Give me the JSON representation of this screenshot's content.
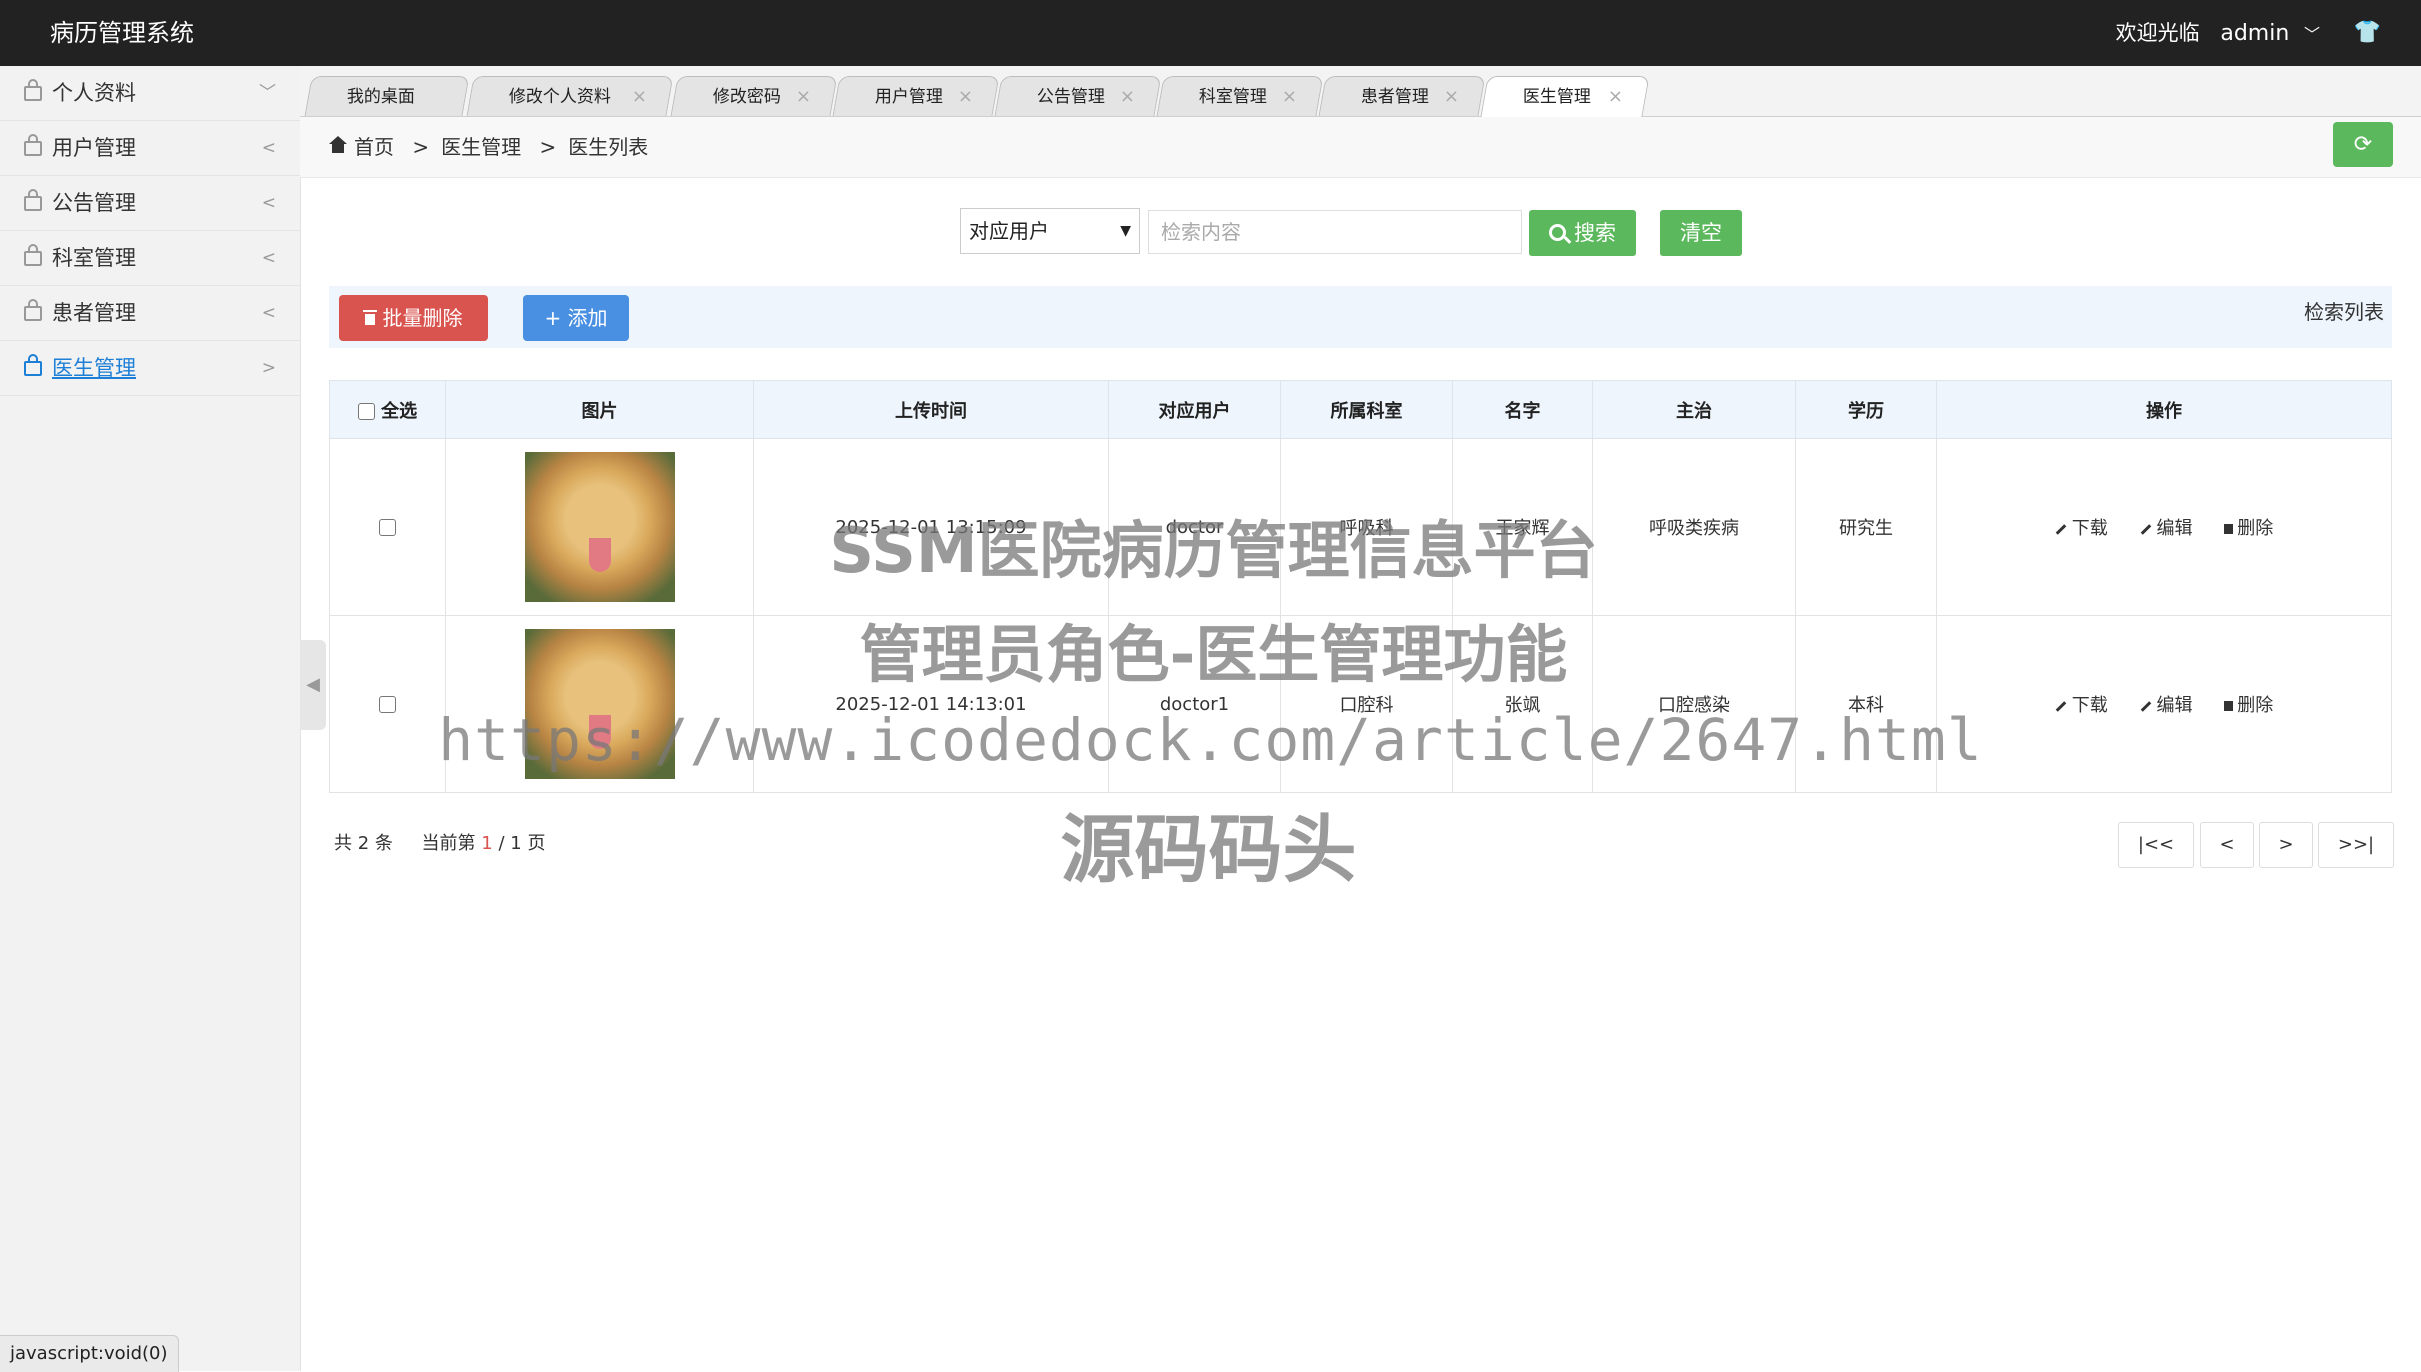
{
  "app": {
    "title": "病历管理系统",
    "welcome": "欢迎光临",
    "user": "admin"
  },
  "sidebar": {
    "items": [
      {
        "label": "个人资料",
        "arrow": "﹀"
      },
      {
        "label": "用户管理",
        "arrow": "<"
      },
      {
        "label": "公告管理",
        "arrow": "<"
      },
      {
        "label": "科室管理",
        "arrow": "<"
      },
      {
        "label": "患者管理",
        "arrow": "<"
      },
      {
        "label": "医生管理",
        "arrow": ">"
      }
    ],
    "collapse_glyph": "◀"
  },
  "tabs": [
    {
      "label": "我的桌面",
      "close": ""
    },
    {
      "label": "修改个人资料",
      "close": "×"
    },
    {
      "label": "修改密码",
      "close": "×"
    },
    {
      "label": "用户管理",
      "close": "×"
    },
    {
      "label": "公告管理",
      "close": "×"
    },
    {
      "label": "科室管理",
      "close": "×"
    },
    {
      "label": "患者管理",
      "close": "×"
    },
    {
      "label": "医生管理",
      "close": "×"
    }
  ],
  "breadcrumb": {
    "home": "首页",
    "sep": ">",
    "level1": "医生管理",
    "level2": "医生列表"
  },
  "search": {
    "select_value": "对应用户",
    "placeholder": "检索内容",
    "search_label": "搜索",
    "clear_label": "清空"
  },
  "actions": {
    "batch_delete": "批量删除",
    "add": "添加",
    "list_title": "检索列表"
  },
  "table": {
    "headers": {
      "select_all": "全选",
      "image": "图片",
      "upload_time": "上传时间",
      "user": "对应用户",
      "dept": "所属科室",
      "name": "名字",
      "specialty": "主治",
      "education": "学历",
      "ops": "操作"
    },
    "rows": [
      {
        "upload_time": "2025-12-01 13:15:09",
        "user": "doctor",
        "dept": "呼吸科",
        "name": "王家辉",
        "specialty": "呼吸类疾病",
        "education": "研究生"
      },
      {
        "upload_time": "2025-12-01 14:13:01",
        "user": "doctor1",
        "dept": "口腔科",
        "name": "张飒",
        "specialty": "口腔感染",
        "education": "本科"
      }
    ],
    "ops": {
      "download": "下载",
      "edit": "编辑",
      "delete": "删除"
    }
  },
  "pagination": {
    "total_prefix": "共",
    "total": "2",
    "total_suffix": "条",
    "current_prefix": "当前第",
    "current": "1",
    "slash": "/",
    "pages": "1",
    "pages_suffix": "页",
    "first": "|<<",
    "prev": "<",
    "next": ">",
    "last": ">>|"
  },
  "watermark": {
    "line1": "SSM医院病历管理信息平台",
    "line2": "管理员角色-医生管理功能",
    "line3": "https://www.icodedock.com/article/2647.html",
    "line4": "源码码头"
  },
  "status_bar": "javascript:void(0)",
  "colors": {
    "topbar": "#222222",
    "success": "#5cb85c",
    "danger": "#d9534f",
    "primary": "#4a90e2",
    "link": "#1e7fd6"
  }
}
